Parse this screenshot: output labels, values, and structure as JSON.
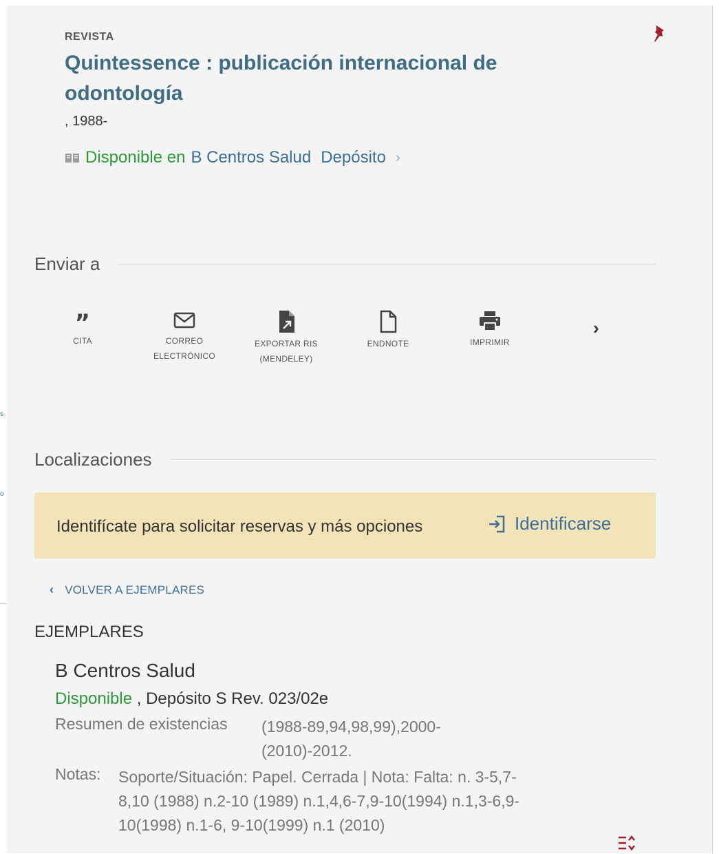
{
  "record": {
    "type_label": "REVISTA",
    "title": "Quintessence : publicación internacional de odontología",
    "date": ", 1988-",
    "availability": {
      "status": "Disponible en",
      "library": "B Centros Salud",
      "location": "Depósito",
      "chevron": "›"
    }
  },
  "send_to": {
    "heading": "Enviar a",
    "actions": [
      {
        "label": "CITA",
        "icon": "quote-icon"
      },
      {
        "label": "CORREO ELECTRÓNICO",
        "icon": "email-icon"
      },
      {
        "label": "EXPORTAR RIS (MENDELEY)",
        "icon": "export-file-icon"
      },
      {
        "label": "ENDNOTE",
        "icon": "document-icon"
      },
      {
        "label": "IMPRIMIR",
        "icon": "printer-icon"
      }
    ],
    "next_arrow": "›"
  },
  "locations": {
    "heading": "Localizaciones",
    "login_prompt": "Identifícate para solicitar reservas y más opciones",
    "login_link": "Identificarse",
    "back_link": "VOLVER A EJEMPLARES",
    "back_chevron": "‹",
    "items_heading": "EJEMPLARES",
    "item": {
      "library": "B Centros Salud",
      "status": "Disponible",
      "call_number": ", Depósito S Rev. 023/02e",
      "summary_label": "Resumen de existencias",
      "summary_value": "(1988-89,94,98,99),2000-(2010)-2012.",
      "notes_label": "Notas:",
      "notes_value": "Soporte/Situación: Papel. Cerrada | Nota: Falta: n. 3-5,7-8,10 (1988) n.2-10 (1989) n.1,4,6-7,9-10(1994) n.1,3-6,9-10(1998) n.1-6, 9-10(1999) n.1 (2010)"
    }
  },
  "colors": {
    "panel_bg": "#f4f4f4",
    "title_blue": "#3f6d84",
    "link_blue": "#3d6f98",
    "available_green": "#2c9a3a",
    "notice_bg": "#f2e4b8",
    "pin_red": "#a3202a"
  }
}
